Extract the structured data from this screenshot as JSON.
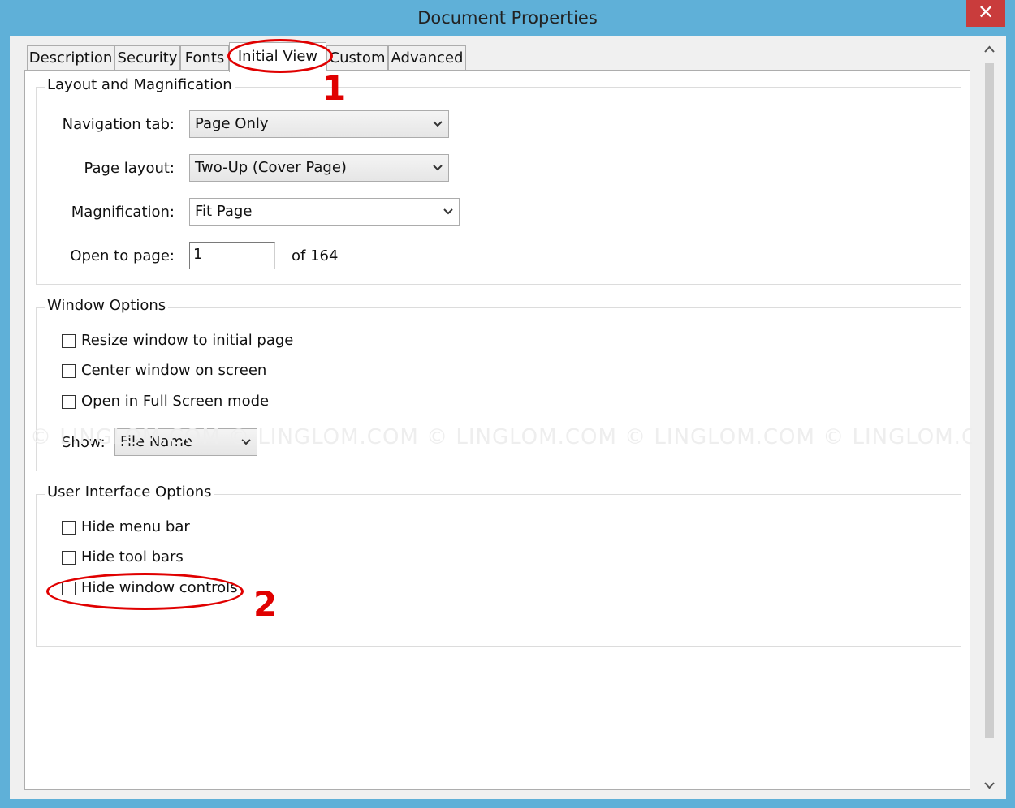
{
  "window": {
    "title": "Document Properties",
    "close_label": "✕"
  },
  "tabs": [
    {
      "label": "Description"
    },
    {
      "label": "Security"
    },
    {
      "label": "Fonts"
    },
    {
      "label": "Initial View"
    },
    {
      "label": "Custom"
    },
    {
      "label": "Advanced"
    }
  ],
  "active_tab": "Initial View",
  "layout_group": {
    "title": "Layout and Magnification",
    "navigation_tab": {
      "label": "Navigation tab:",
      "value": "Page Only"
    },
    "page_layout": {
      "label": "Page layout:",
      "value": "Two-Up (Cover Page)"
    },
    "magnification": {
      "label": "Magnification:",
      "value": "Fit Page"
    },
    "open_to_page": {
      "label": "Open to page:",
      "value": "1",
      "of_text": "of 164"
    }
  },
  "window_group": {
    "title": "Window Options",
    "options": [
      {
        "label": "Resize window to initial page",
        "checked": false
      },
      {
        "label": "Center window on screen",
        "checked": false
      },
      {
        "label": "Open in Full Screen mode",
        "checked": false
      }
    ],
    "show": {
      "label": "Show:",
      "value": "File Name"
    }
  },
  "ui_group": {
    "title": "User Interface Options",
    "options": [
      {
        "label": "Hide menu bar",
        "checked": false
      },
      {
        "label": "Hide tool bars",
        "checked": false
      },
      {
        "label": "Hide window controls",
        "checked": false
      }
    ]
  },
  "annotations": {
    "first": "1",
    "second": "2"
  },
  "watermark": "© LINGLOM.COM    © LINGLOM.COM    © LINGLOM.COM    © LINGLOM.COM    © LINGLOM.COM",
  "colors": {
    "title_bar": "#5fb0d8",
    "close_button": "#c93c3c",
    "annotation": "#e00000"
  }
}
